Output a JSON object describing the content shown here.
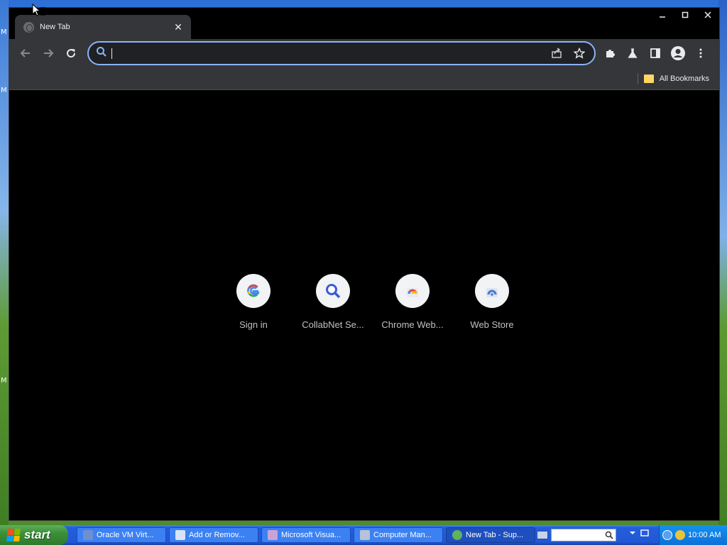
{
  "desktop": {
    "left_letters": [
      "M",
      "M",
      "M"
    ]
  },
  "window": {
    "controls": {
      "minimize_icon": "minimize-icon",
      "maximize_icon": "maximize-icon",
      "close_icon": "close-icon"
    }
  },
  "tab": {
    "title": "New Tab",
    "favicon": "globe-icon",
    "close_icon": "close-icon"
  },
  "toolbar": {
    "back_icon": "arrow-left-icon",
    "forward_icon": "arrow-right-icon",
    "reload_icon": "reload-icon",
    "omnibox": {
      "value": "",
      "search_icon": "search-icon",
      "share_icon": "share-icon",
      "bookmark_icon": "star-icon"
    },
    "extensions_icon": "puzzle-icon",
    "labs_icon": "flask-icon",
    "side_panel_icon": "side-panel-icon",
    "profile_icon": "avatar-icon",
    "menu_icon": "kebab-menu-icon"
  },
  "bookmarks_bar": {
    "all_bookmarks": "All Bookmarks"
  },
  "shortcuts": [
    {
      "label": "Sign in",
      "icon": "google-g-icon"
    },
    {
      "label": "CollabNet Se...",
      "icon": "search-magnifier-icon"
    },
    {
      "label": "Chrome Web...",
      "icon": "chrome-web-store-icon"
    },
    {
      "label": "Web Store",
      "icon": "web-store-icon"
    }
  ],
  "taskbar": {
    "start_label": "start",
    "items": [
      {
        "label": "Oracle VM Virt...",
        "icon": "virtualbox-icon",
        "active": false
      },
      {
        "label": "Add or Remov...",
        "icon": "add-remove-programs-icon",
        "active": false
      },
      {
        "label": "Microsoft Visua...",
        "icon": "visual-studio-icon",
        "active": false
      },
      {
        "label": "Computer Man...",
        "icon": "computer-management-icon",
        "active": false
      },
      {
        "label": "New Tab - Sup...",
        "icon": "chrome-icon",
        "active": true
      }
    ],
    "clock": "10:00 AM"
  },
  "colors": {
    "ntp_background": "#000000",
    "toolbar": "#35363a",
    "omnibox_focus": "#8ab4f8",
    "taskbar": "#245edb",
    "start_green": "#3c8f39"
  }
}
